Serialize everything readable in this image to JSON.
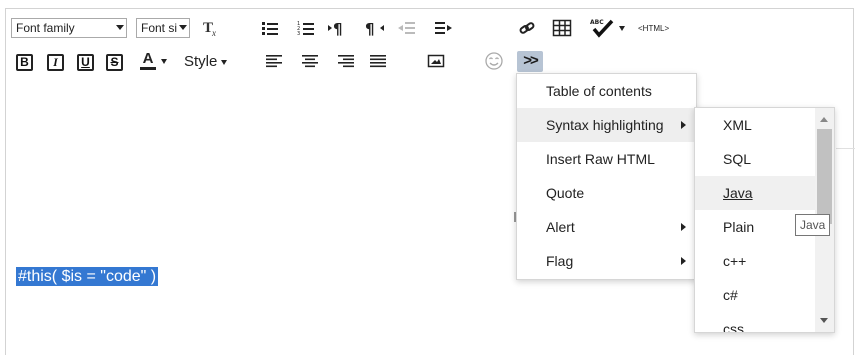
{
  "toolbar": {
    "font_family": "Font family",
    "font_size": "Font si",
    "bold": "B",
    "italic": "I",
    "underline": "U",
    "strike": "S",
    "font_color": "A",
    "style": "Style",
    "more": ">>",
    "html": "<HTML>",
    "spell": "ABC"
  },
  "content": {
    "selected_text": "#this( $is = \"code\" )"
  },
  "menu": {
    "items": [
      {
        "label": "Table of contents"
      },
      {
        "label": "Syntax highlighting"
      },
      {
        "label": "Insert Raw HTML"
      },
      {
        "label": "Quote"
      },
      {
        "label": "Alert"
      },
      {
        "label": "Flag"
      }
    ]
  },
  "submenu": {
    "items": [
      {
        "label": "XML"
      },
      {
        "label": "SQL"
      },
      {
        "label": "Java"
      },
      {
        "label": "Plain"
      },
      {
        "label": "c++"
      },
      {
        "label": "c#"
      },
      {
        "label": "css"
      }
    ]
  },
  "tooltip": "Java",
  "colors": {
    "selection": "#3478d2",
    "more_button": "#b7c4d4",
    "menu_active": "#eeeeee"
  }
}
